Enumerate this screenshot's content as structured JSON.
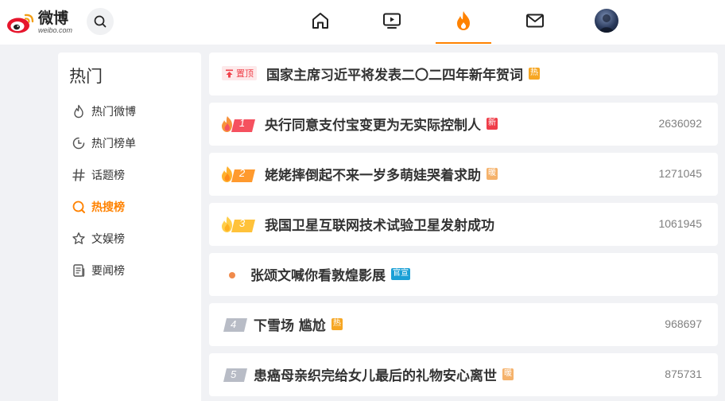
{
  "brand": {
    "name_cn": "微博",
    "name_en": "weibo.com",
    "brand_color": "#ff8200",
    "logo_red": "#e6162d"
  },
  "nav": {
    "items": [
      "home-icon",
      "video-icon",
      "hot-flame-icon",
      "mail-icon",
      "avatar"
    ],
    "active": "hot-flame-icon"
  },
  "sidebar": {
    "title": "热门",
    "items": [
      {
        "label": "热门微博",
        "icon": "flame-outline-icon",
        "active": false
      },
      {
        "label": "热门榜单",
        "icon": "clock-chart-icon",
        "active": false
      },
      {
        "label": "话题榜",
        "icon": "hashtag-icon",
        "active": false
      },
      {
        "label": "热搜榜",
        "icon": "hot-search-icon",
        "active": true
      },
      {
        "label": "文娱榜",
        "icon": "star-icon",
        "active": false
      },
      {
        "label": "要闻榜",
        "icon": "news-icon",
        "active": false
      }
    ]
  },
  "hot_list": {
    "pinned": {
      "tag": "置顶",
      "title": "国家主席习近平将发表二〇二四年新年贺词",
      "badge": "热",
      "badge_color": "#f6a623"
    },
    "items": [
      {
        "rank": "1",
        "title": "央行同意支付宝变更为无实际控制人",
        "badge": "新",
        "badge_color": "#ef3d49",
        "count": "2636092"
      },
      {
        "rank": "2",
        "title": "姥姥摔倒起不来一岁多萌娃哭着求助",
        "badge": "暖",
        "badge_color": "#f5b26b",
        "count": "1271045"
      },
      {
        "rank": "3",
        "title": "我国卫星互联网技术试验卫星发射成功",
        "badge": "",
        "badge_color": "",
        "count": "1061945"
      },
      {
        "rank": "",
        "title": "张颂文喊你看敦煌影展",
        "badge": "官宣",
        "badge_color": "#1ba0d6",
        "count": ""
      },
      {
        "rank": "4",
        "title": "下雪场 尴尬",
        "badge": "热",
        "badge_color": "#f6a623",
        "count": "968697"
      },
      {
        "rank": "5",
        "title": "患癌母亲织完给女儿最后的礼物安心离世",
        "badge": "暖",
        "badge_color": "#f5b26b",
        "count": "875731"
      }
    ]
  }
}
